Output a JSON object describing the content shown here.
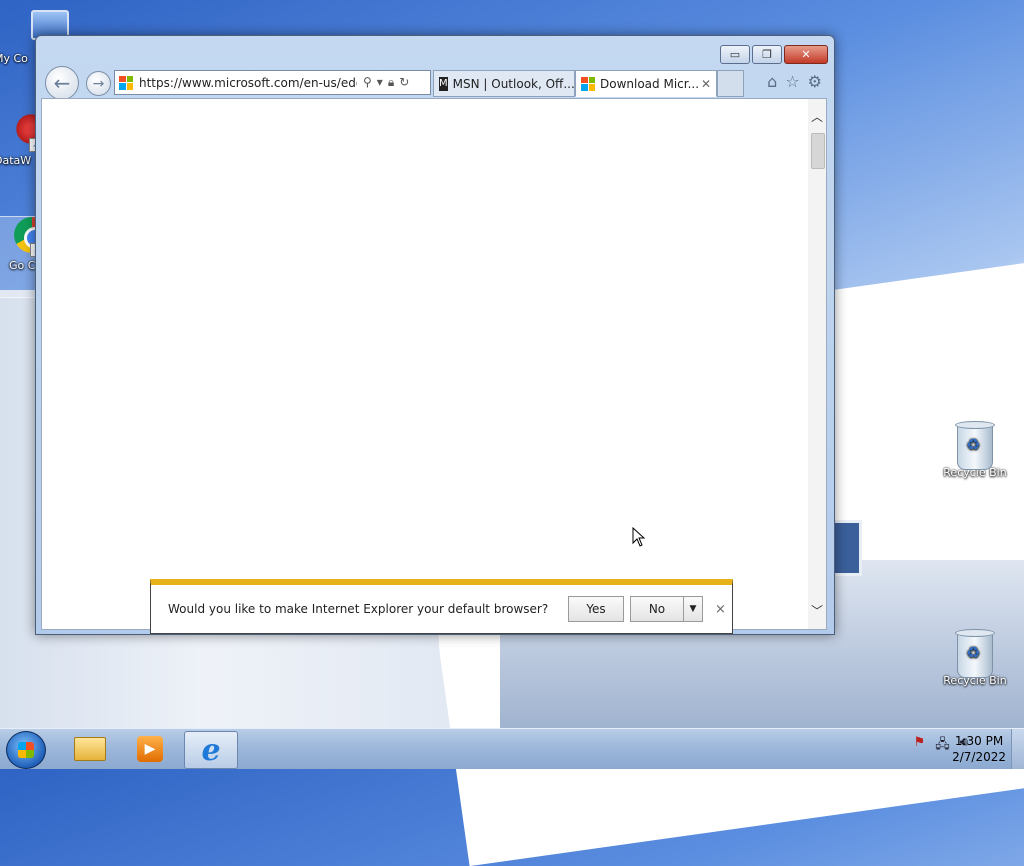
{
  "desktop": {
    "icons": [
      {
        "label": "My Co"
      },
      {
        "label": "DataW"
      },
      {
        "label": "Go Chr"
      },
      {
        "label": "Recycle Bin"
      },
      {
        "label": "Recycle Bin"
      }
    ]
  },
  "browser": {
    "address": "https://www.microsoft.com/en-us/edge",
    "tabs": [
      {
        "label": "MSN | Outlook, Off..."
      },
      {
        "label": "Download Micr..."
      }
    ],
    "window_controls": {
      "minimize": "▭",
      "restore": "❐",
      "close": "✕"
    }
  },
  "notification": {
    "message": "Would you like to make Internet Explorer your default browser?",
    "yes_label": "Yes",
    "no_label": "No",
    "close": "×"
  },
  "taskbar": {
    "time": "1:30 PM",
    "date": "2/7/2022"
  },
  "colors": {
    "notify_accent": "#e8b21a",
    "close_button": "#c23a28"
  }
}
